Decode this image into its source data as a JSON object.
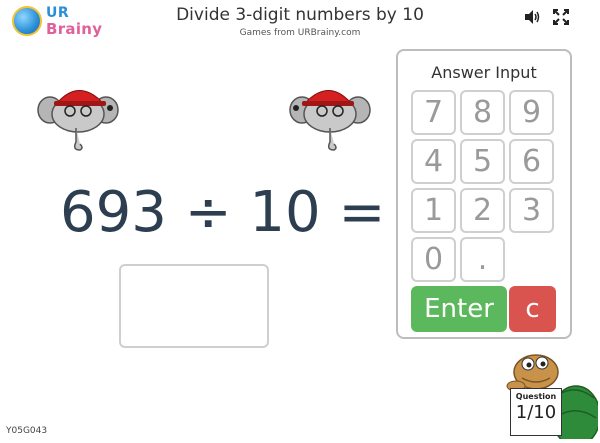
{
  "logo": {
    "text_top": "UR",
    "text_bottom": "Brainy"
  },
  "header": {
    "title": "Divide 3-digit numbers by 10",
    "subtitle": "Games from URBrainy.com"
  },
  "toolbar": {
    "sound_icon": "speaker-icon",
    "fullscreen_icon": "fullscreen-icon"
  },
  "question": {
    "text": "693 ÷ 10 ="
  },
  "answer": {
    "value": ""
  },
  "keypad": {
    "title": "Answer Input",
    "keys": [
      "7",
      "8",
      "9",
      "4",
      "5",
      "6",
      "1",
      "2",
      "3",
      "0",
      "."
    ],
    "enter_label": "Enter",
    "clear_label": "c"
  },
  "progress": {
    "label": "Question",
    "value": "1/10"
  },
  "footer": {
    "code": "Y05G043"
  },
  "colors": {
    "enter": "#5cb85c",
    "clear": "#d9534f",
    "question": "#2d3e50"
  }
}
